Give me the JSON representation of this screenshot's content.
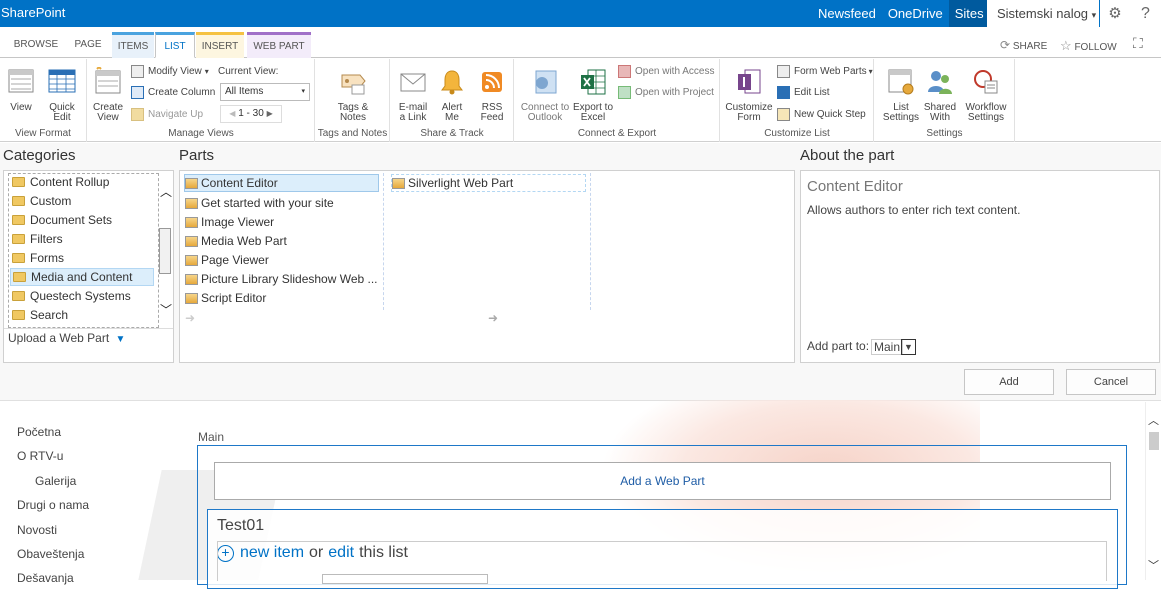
{
  "suitebar": {
    "brand": "SharePoint",
    "links": [
      "Newsfeed",
      "OneDrive",
      "Sites"
    ],
    "user": "Sistemski nalog",
    "user_caret": "▾",
    "gear_icon": "gear-icon",
    "help": "?"
  },
  "tabs": {
    "items": [
      "BROWSE",
      "PAGE",
      "ITEMS",
      "LIST",
      "INSERT",
      "WEB PART"
    ],
    "share": "SHARE",
    "follow": "FOLLOW"
  },
  "ribbon": {
    "view_format": {
      "name": "View Format",
      "view": "View",
      "quick_edit": "Quick Edit"
    },
    "manage_views": {
      "name": "Manage Views",
      "create_view": "Create View",
      "modify_view": "Modify View",
      "create_column": "Create Column",
      "navigate_up": "Navigate Up",
      "current_view_label": "Current View:",
      "current_view_value": "All Items",
      "paging": "1 - 30"
    },
    "tags_notes": {
      "name": "Tags and Notes",
      "tags_notes": "Tags & Notes"
    },
    "share_track": {
      "name": "Share & Track",
      "email": "E-mail a Link",
      "alert": "Alert Me",
      "rss": "RSS Feed"
    },
    "connect_export": {
      "name": "Connect & Export",
      "outlook": "Connect to Outlook",
      "excel": "Export to Excel",
      "access": "Open with Access",
      "project": "Open with Project"
    },
    "customize_list": {
      "name": "Customize List",
      "customize_form": "Customize Form",
      "form_web_parts": "Form Web Parts",
      "edit_list": "Edit List",
      "new_quick_step": "New Quick Step"
    },
    "settings": {
      "name": "Settings",
      "list_settings": "List Settings",
      "shared_with": "Shared With",
      "workflow_settings": "Workflow Settings"
    }
  },
  "panel": {
    "categories_title": "Categories",
    "parts_title": "Parts",
    "about_title": "About the part",
    "categories": [
      "Content Rollup",
      "Custom",
      "Document Sets",
      "Filters",
      "Forms",
      "Media and Content",
      "Questech Systems",
      "Search"
    ],
    "selected_category": "Media and Content",
    "upload": "Upload a Web Part",
    "parts_col1": [
      "Content Editor",
      "Get started with your site",
      "Image Viewer",
      "Media Web Part",
      "Page Viewer",
      "Picture Library Slideshow Web ...",
      "Script Editor"
    ],
    "parts_col2": [
      "Silverlight Web Part"
    ],
    "about_name": "Content Editor",
    "about_desc": "Allows authors to enter rich text content.",
    "add_part_to": "Add part to:",
    "zone_value": "Main",
    "add_button": "Add",
    "cancel_button": "Cancel"
  },
  "quicklaunch": [
    "Početna",
    "O RTV-u",
    "Galerija",
    "Drugi o nama",
    "Novosti",
    "Obaveštenja",
    "Dešavanja"
  ],
  "page": {
    "zone_label": "Main",
    "add_web_part": "Add a Web Part",
    "list_title": "Test01",
    "new_item": "new item",
    "or": "or",
    "edit": "edit",
    "this_list": "this list"
  }
}
